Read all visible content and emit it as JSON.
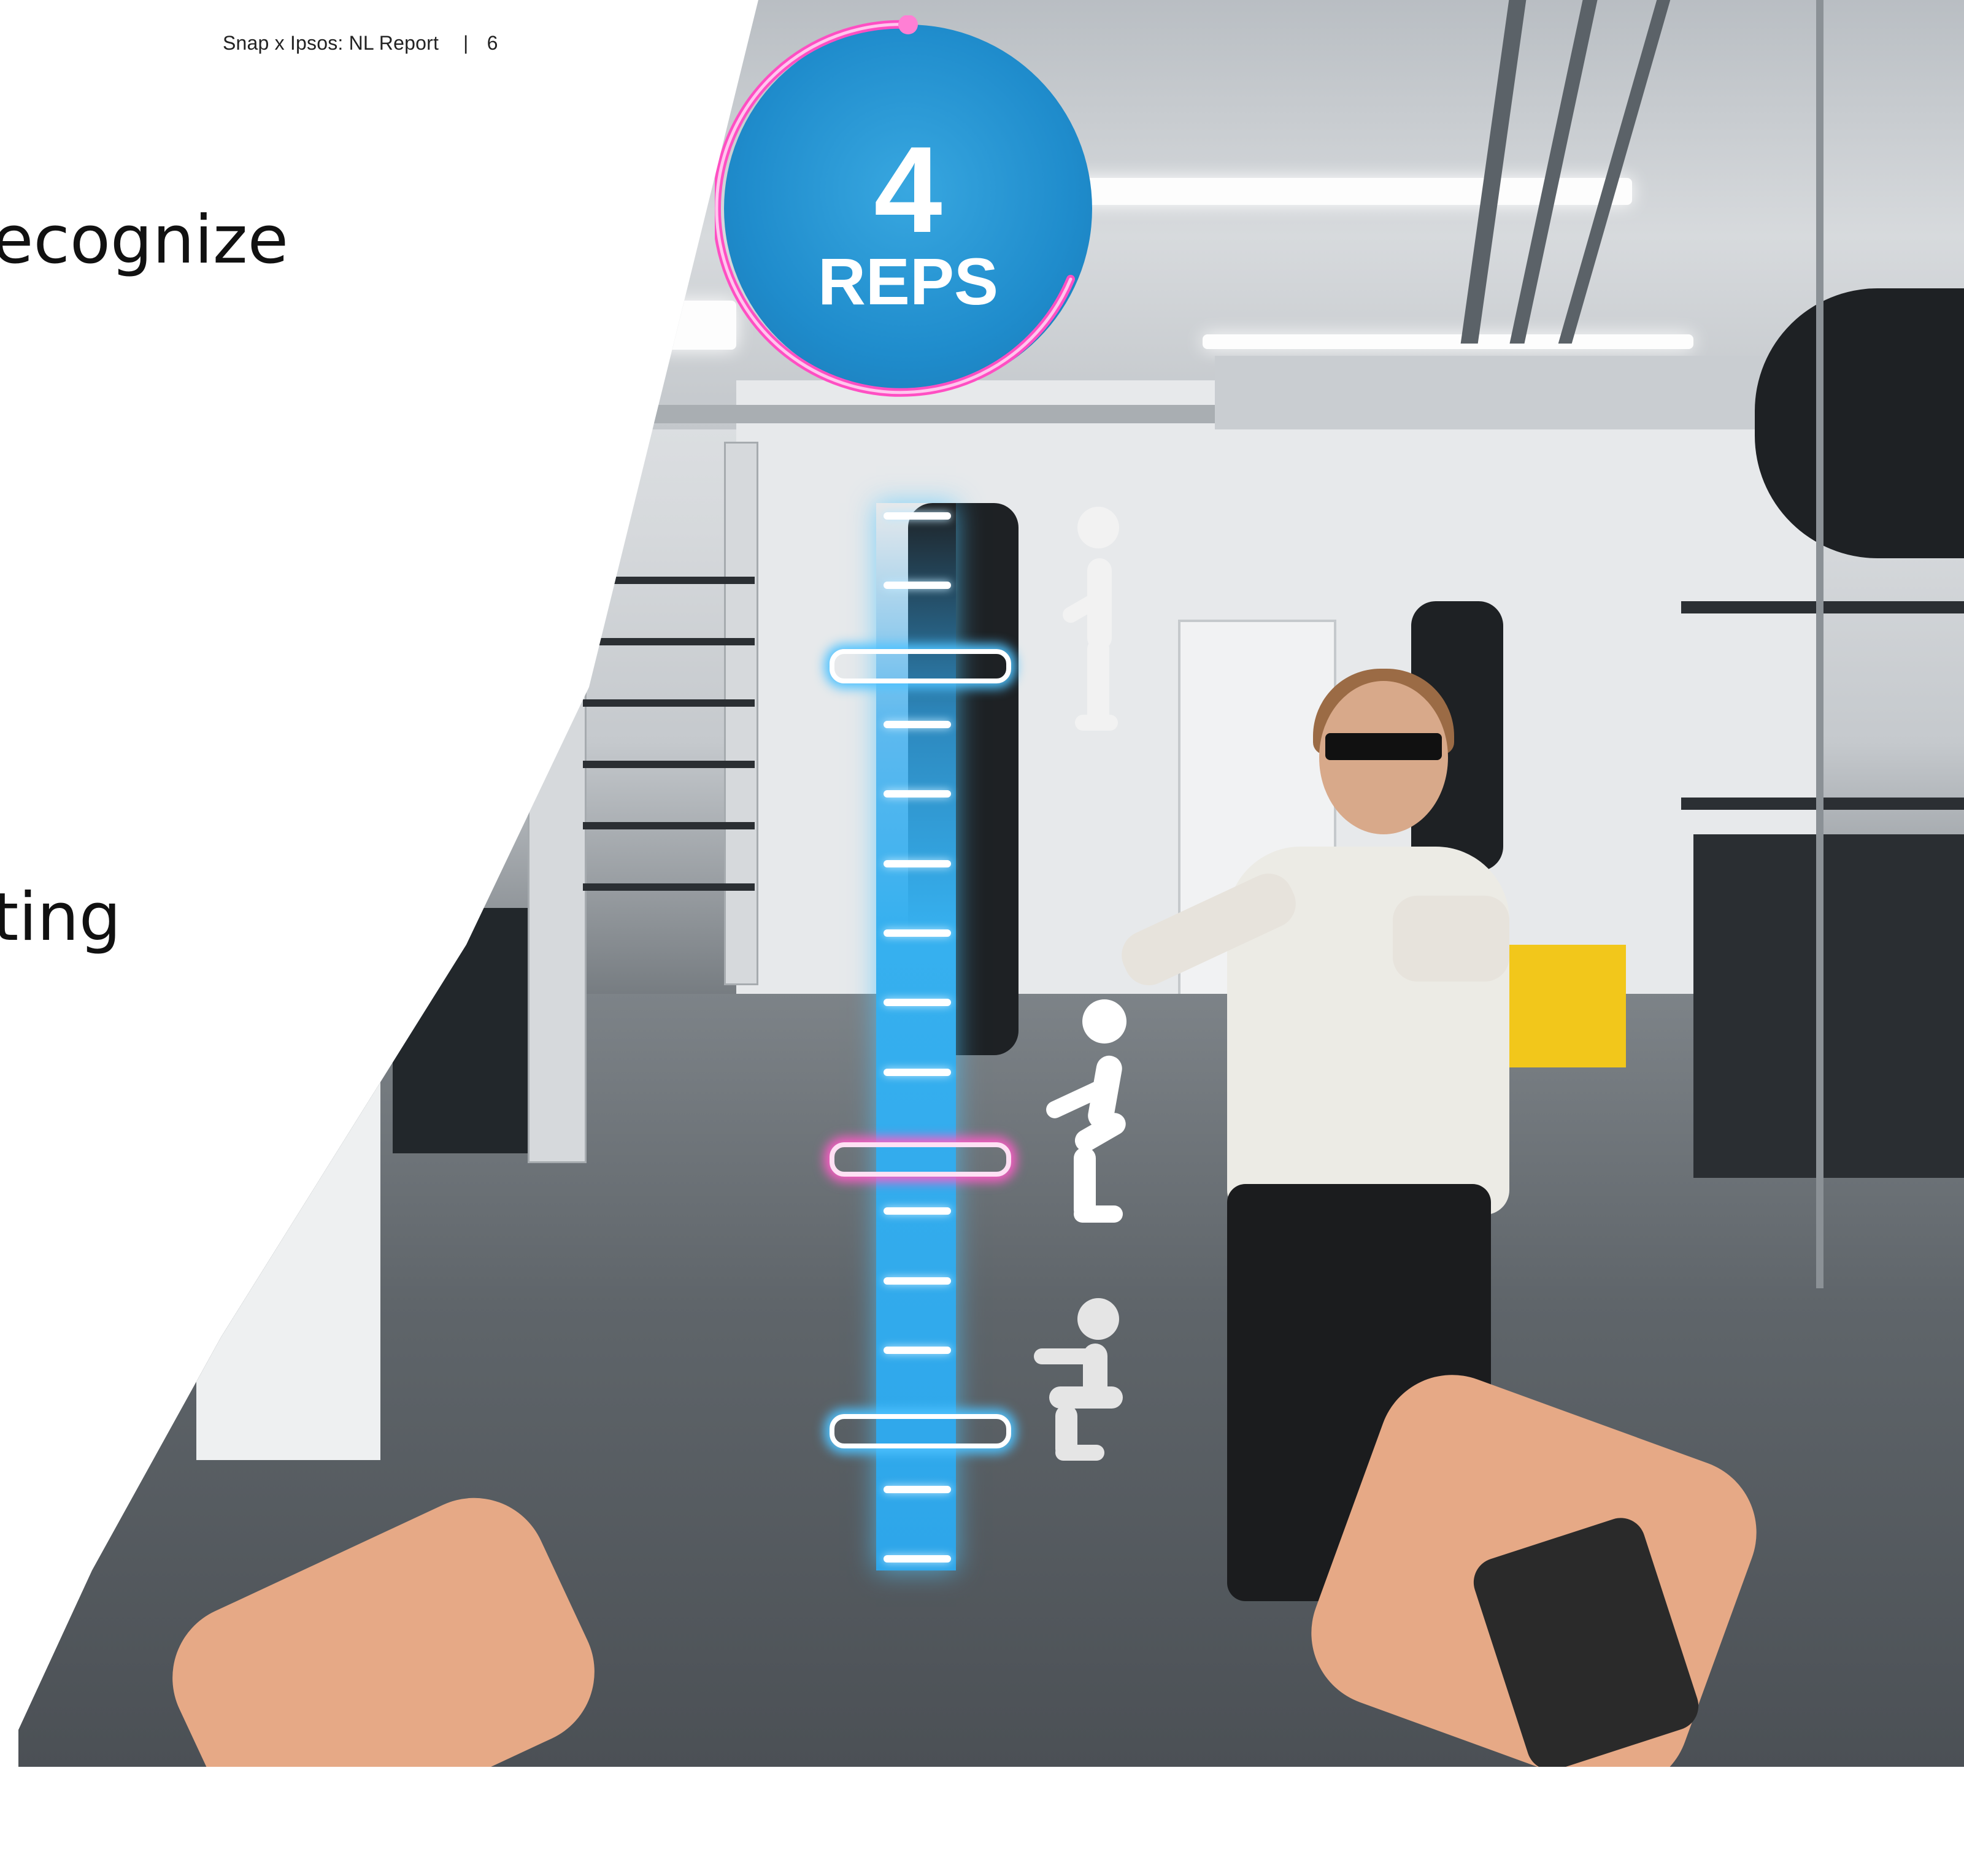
{
  "header": {
    "report_title": "Snap x Ipsos: NL Report",
    "separator": "|",
    "page_number": "6"
  },
  "headlines": {
    "line1": "ecognize",
    "line2": "ting"
  },
  "ar_overlay": {
    "rep_count": "4",
    "rep_label": "REPS",
    "ring_color": "#ff4fc3",
    "meter_color": "#2ea6ea",
    "pose_icons": [
      "standing-pose-icon",
      "half-squat-pose-icon",
      "full-squat-pose-icon"
    ]
  },
  "colors": {
    "text": "#111111",
    "circle": "#1f8ccc",
    "pink_marker": "#ff5cc8",
    "blue_marker": "#4fc3ff"
  }
}
